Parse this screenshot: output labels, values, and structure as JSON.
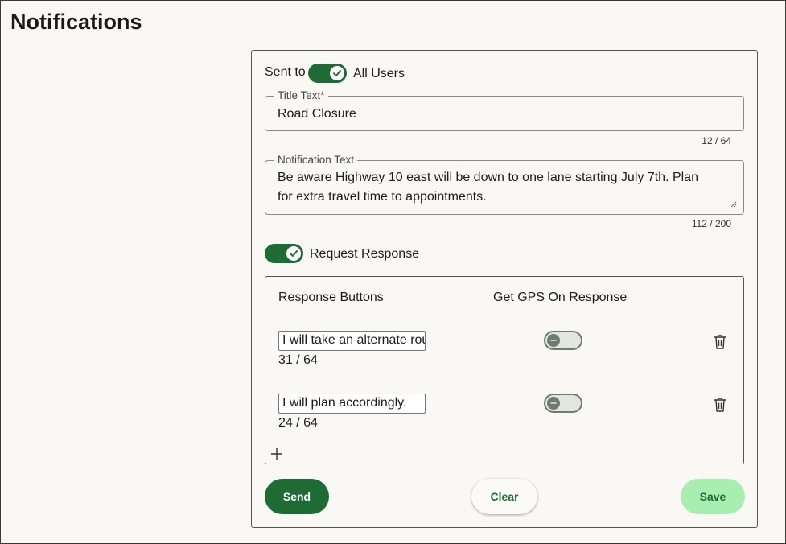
{
  "page": {
    "title": "Notifications"
  },
  "sent_to": {
    "label": "Sent to",
    "toggle_on": true,
    "value_label": "All Users"
  },
  "title_field": {
    "label": "Title Text*",
    "value": "Road Closure",
    "counter": "12 / 64"
  },
  "notification_field": {
    "label": "Notification Text",
    "line1": "Be aware Highway 10 east will be down to one lane starting July 7th. Plan",
    "line2": "for extra travel time to appointments.",
    "counter": "112 / 200"
  },
  "request_response": {
    "label": "Request Response",
    "toggle_on": true
  },
  "responses": {
    "col_buttons": "Response Buttons",
    "col_gps": "Get GPS On Response",
    "items": [
      {
        "value": "I will take an alternate route.",
        "counter": "31 / 64",
        "gps_on": false
      },
      {
        "value": "I will plan accordingly.",
        "counter": "24 / 64",
        "gps_on": false
      }
    ]
  },
  "actions": {
    "send": "Send",
    "clear": "Clear",
    "save": "Save"
  },
  "colors": {
    "primary": "#1f6b35",
    "save_bg": "#a9eeb1",
    "toggle_off_bg": "#e2e6dd",
    "background": "#faf8f5"
  },
  "icons": {
    "check": "check-icon",
    "minus": "minus-icon",
    "trash": "trash-icon",
    "plus": "plus-icon",
    "resize": "resize-handle-icon"
  }
}
